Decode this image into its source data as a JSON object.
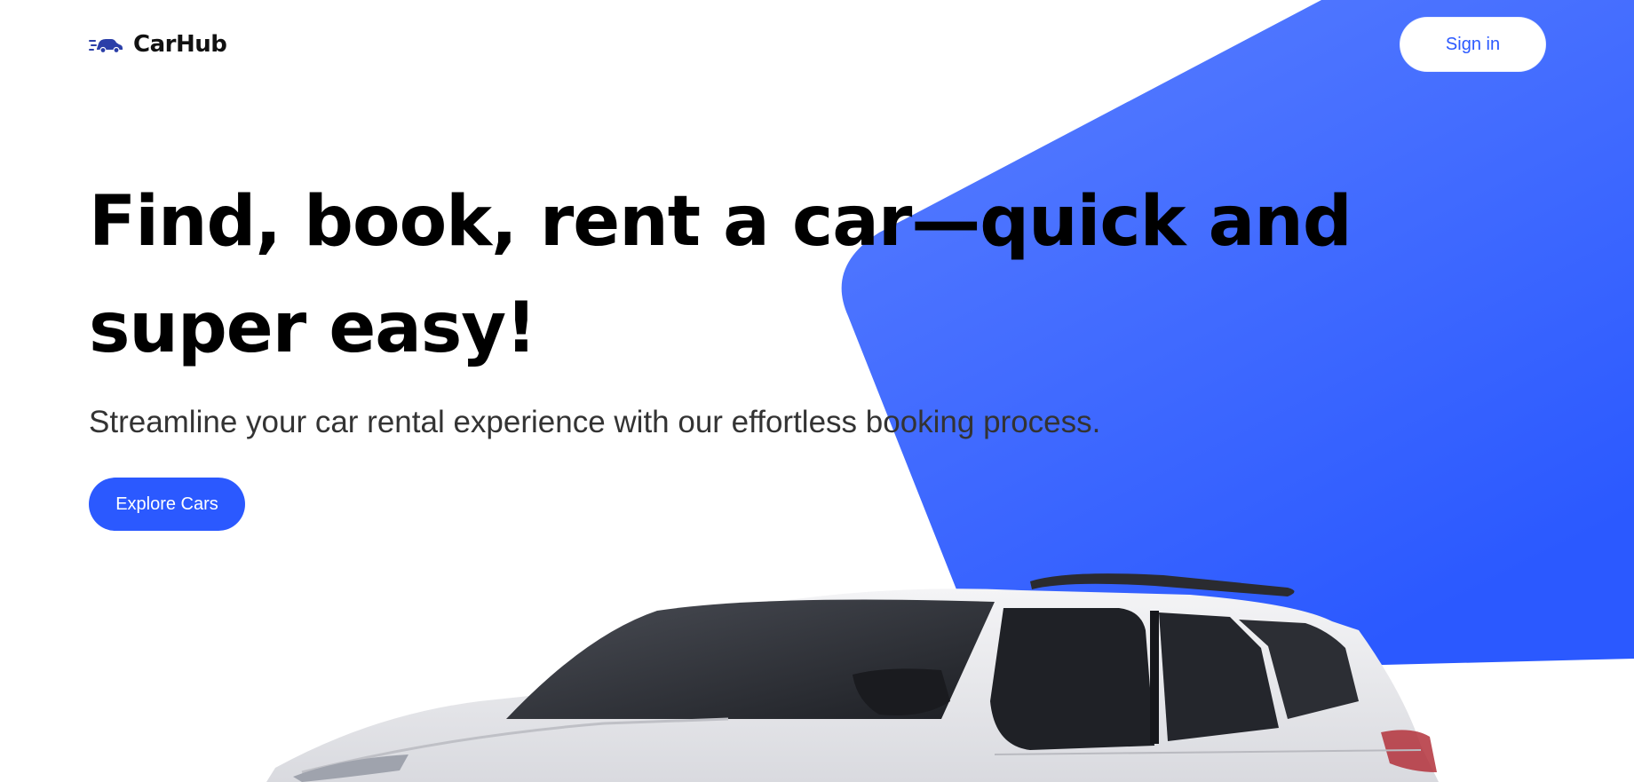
{
  "brand": {
    "name": "CarHub",
    "icon": "car-speed-icon"
  },
  "nav": {
    "signin_label": "Sign in"
  },
  "hero": {
    "title": "Find, book, rent a car—quick and super easy!",
    "subtitle": "Streamline your car rental experience with our effortless booking process.",
    "cta_label": "Explore Cars"
  },
  "colors": {
    "accent": "#2b59ff",
    "accent_light": "#4f77ff",
    "text_dark": "#000000",
    "text_muted": "#333333"
  },
  "images": {
    "hero_image": "white-suv-image"
  }
}
